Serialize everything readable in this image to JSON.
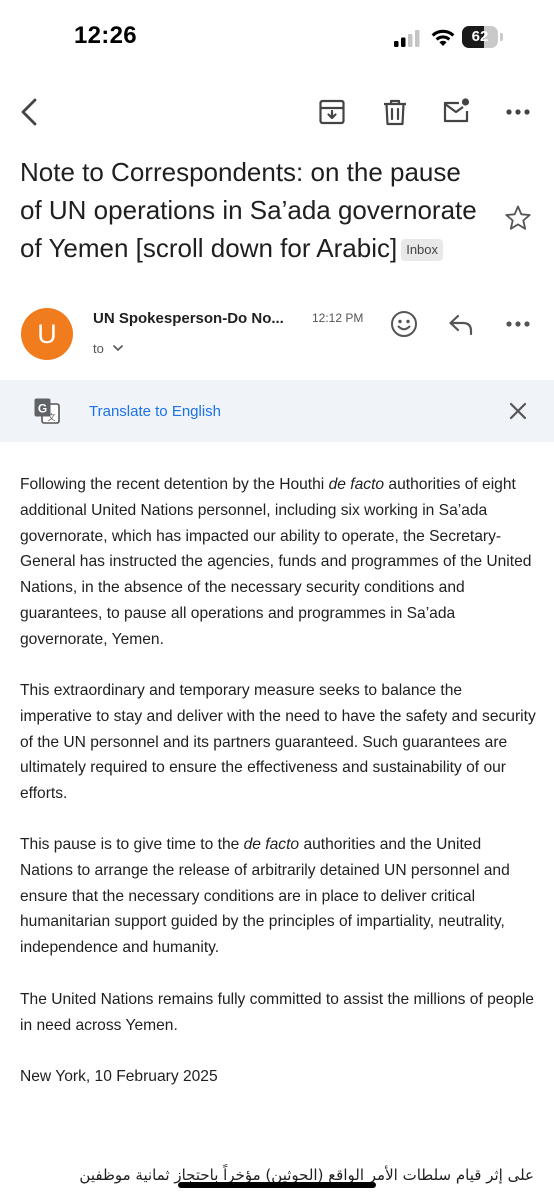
{
  "status_bar": {
    "time": "12:26",
    "battery_percent": "62",
    "battery_level": 0.62
  },
  "toolbar": {
    "icons": [
      "back-arrow-icon",
      "archive-icon",
      "trash-icon",
      "mark-unread-icon",
      "more-vert-icon"
    ]
  },
  "email": {
    "subject_lines": [
      "Note to Correspondents:  on the pause",
      "of UN operations in Sa’ada governorate",
      "of Yemen [scroll down for Arabic]"
    ],
    "label": "Inbox",
    "avatar_letter": "U",
    "avatar_color": "#f07c1e",
    "sender": "UN Spokesperson-Do No...",
    "time": "12:12 PM",
    "to_label": "to"
  },
  "translate_bar": {
    "link_text": "Translate to English",
    "link_color": "#1a73e8"
  },
  "body": {
    "p1": {
      "a": "Following the recent detention by the Houthi ",
      "a_em": "de facto",
      "b": " authorities of eight additional United Nations personnel, including six working in Sa’ada governorate, which has impacted our ability to operate, the Secretary-General has instructed the agencies, funds and programmes of the United Nations, in the absence of the necessary security conditions and guarantees, to pause all operations and programmes in Sa’ada governorate, Yemen."
    },
    "p2": "This extraordinary and temporary measure seeks to balance the imperative to stay and deliver with the need to have the safety and security of the UN personnel and its partners guaranteed. Such guarantees are ultimately required to ensure the effectiveness and sustainability of our efforts.",
    "p3": {
      "a": "This pause is to give time to the ",
      "a_em": "de facto",
      "b": " authorities and the United Nations to arrange the release of arbitrarily detained UN personnel and ensure that the necessary conditions are in place to deliver critical humanitarian support guided by the principles of impartiality, neutrality, independence and humanity."
    },
    "p4": "The United Nations remains fully committed to assist the millions of people in need across Yemen.",
    "dateline": "New York, 10 February 2025",
    "arabic": "على إثر قيام سلطات الأمر الواقع (الحوثين) مؤخراً باحتجاز ثمانية موظفين"
  }
}
